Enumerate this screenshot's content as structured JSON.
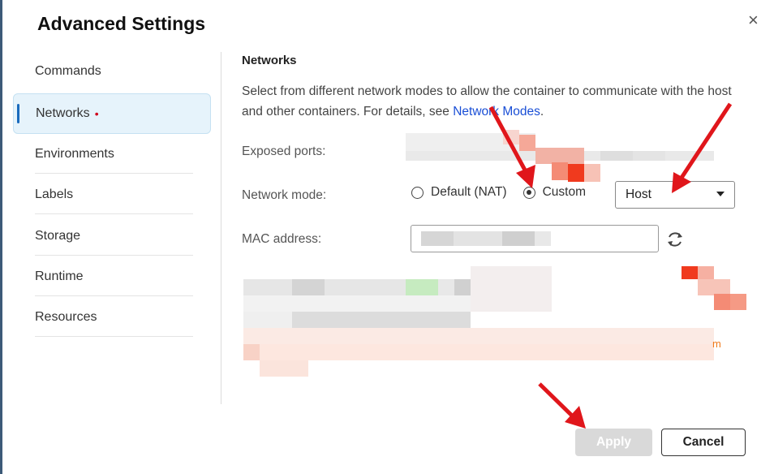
{
  "dialog": {
    "title": "Advanced Settings",
    "close_glyph": "×"
  },
  "sidebar": {
    "items": [
      {
        "label": "Commands"
      },
      {
        "label": "Networks",
        "indicator": "•"
      },
      {
        "label": "Environments"
      },
      {
        "label": "Labels"
      },
      {
        "label": "Storage"
      },
      {
        "label": "Runtime"
      },
      {
        "label": "Resources"
      }
    ]
  },
  "networks": {
    "section_title": "Networks",
    "description_prefix": "Select from different network modes to allow the container to communicate with the host and other containers. For details, see ",
    "description_link": "Network Modes",
    "description_suffix": ".",
    "exposed_ports_label": "Exposed ports:",
    "network_mode_label": "Network mode:",
    "mode_options": [
      {
        "label": "Default (NAT)",
        "checked": false
      },
      {
        "label": "Custom",
        "checked": true
      }
    ],
    "custom_select_value": "Host",
    "mac_address_label": "MAC address:",
    "mac_address_value": "",
    "orange_tail_text": "m"
  },
  "footer": {
    "apply_label": "Apply",
    "cancel_label": "Cancel"
  },
  "colors": {
    "accent": "#1a6bbd",
    "link": "#1a4fd6",
    "required_dot": "#d0021b",
    "annotation_arrow": "#e0161b",
    "apply_disabled": "#d9d9d9"
  },
  "icons": {
    "close": "close-icon",
    "refresh": "refresh-icon",
    "select_caret": "caret-down-icon"
  }
}
